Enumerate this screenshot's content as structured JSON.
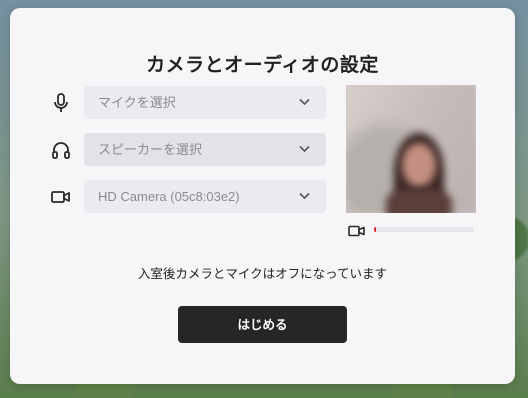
{
  "dialog": {
    "title": "カメラとオーディオの設定",
    "notice": "入室後カメラとマイクはオフになっています",
    "start_button": "はじめる"
  },
  "devices": {
    "microphone": {
      "value": "マイクを選択",
      "icon": "microphone-icon"
    },
    "speaker": {
      "value": "スピーカーを選択",
      "icon": "headphones-icon"
    },
    "camera": {
      "value": "HD Camera (05c8:03e2)",
      "icon": "video-camera-icon"
    }
  },
  "preview": {
    "level_percent": 2,
    "meter_color": "#e02424",
    "icon": "video-camera-icon"
  },
  "colors": {
    "button_bg": "#262628",
    "panel_bg": "#f6f6f8"
  }
}
